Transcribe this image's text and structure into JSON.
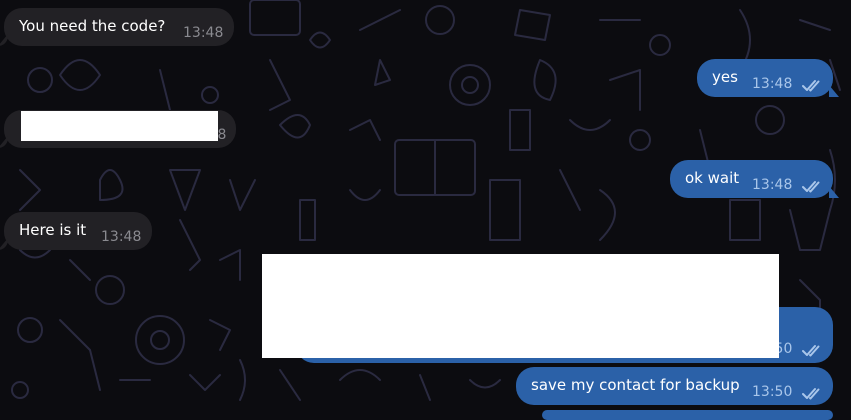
{
  "chat": {
    "messages": [
      {
        "direction": "incoming",
        "text": "You need the code?",
        "time": "13:48"
      },
      {
        "direction": "outgoing",
        "text": "yes",
        "time": "13:48",
        "status": "read"
      },
      {
        "direction": "incoming",
        "text": "",
        "time": "13:48",
        "redacted": true
      },
      {
        "direction": "outgoing",
        "text": "ok wait",
        "time": "13:48",
        "status": "read"
      },
      {
        "direction": "incoming",
        "text": "Here is it",
        "time": "13:48"
      },
      {
        "direction": "outgoing",
        "text": "",
        "time": "13:50",
        "status": "read",
        "redacted": true
      },
      {
        "direction": "outgoing",
        "text": "save my contact for backup",
        "time": "13:50",
        "status": "read"
      }
    ]
  },
  "icons": {
    "read_receipt": "double-check-icon"
  },
  "colors": {
    "background": "#0c0c10",
    "incoming_bubble": "#222125",
    "outgoing_bubble": "#2b61a8",
    "redaction": "#ffffff"
  }
}
